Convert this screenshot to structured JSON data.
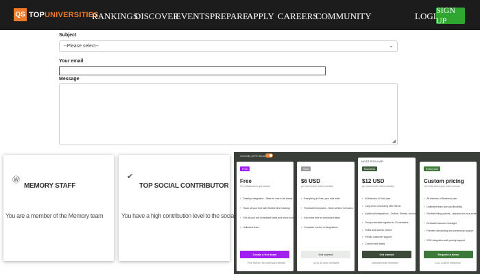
{
  "header": {
    "logo_mark": "QS",
    "logo_text_a": "TOP",
    "logo_text_b": "UNIVERSITIES",
    "nav": [
      "RANKINGS",
      "DISCOVER",
      "EVENTS",
      "PREPARE",
      "APPLY",
      "CAREERS",
      "COMMUNITY"
    ],
    "login_label": "LOGIN",
    "signup_label": "SIGN UP"
  },
  "form": {
    "subject_label": "Subject",
    "subject_value": "--Please select--",
    "email_label": "Your email",
    "email_value": "",
    "message_label": "Message",
    "message_value": ""
  },
  "badges": [
    {
      "icon": "wordpress-icon",
      "title": "MEMORY STAFF",
      "description": "You are a member of the Memory team"
    },
    {
      "icon": "checkmark-badge-icon",
      "title": "TOP SOCIAL CONTRIBUTOR",
      "description": "You have a high contribution level to the social aspects"
    }
  ],
  "pricing": {
    "toggle_label": "Annually (20% discount)",
    "popular_label": "MOST POPULAR",
    "plans": [
      {
        "tag": "Free",
        "tag_color": "#a020f0",
        "name": "Free",
        "subtitle": "For individuals to get started",
        "features": [
          "Desktop integration - Stats for free to all teams",
          "Track all your time with flexible time tracking",
          "Get all your pre-scheduled tasks and show work",
          "Unlimited team"
        ],
        "button": "Create a free team",
        "button_bg": "#a020f0",
        "button_fg": "#ffffff",
        "footnote": "Free forever. No credit card needed"
      },
      {
        "tag": "Solo",
        "tag_color": "#9a9a9a",
        "name": "$6 USD",
        "subtitle": "per user/month, billed monthly",
        "features": [
          "Everything in Free, plus bulk edits",
          "Timesheet templates - Store all time for teams",
          "Add extra time to scheduled tasks",
          "Complete control of integrations"
        ],
        "button": "Get started",
        "button_bg": "#e9ece8",
        "button_fg": "#555555",
        "footnote": "Up to 10 team members"
      },
      {
        "tag": "Business",
        "tag_color": "#3d5a3a",
        "name": "$12 USD",
        "subtitle": "per user/month, billed monthly",
        "features": [
          "All features of Solo plan",
          "Long-term scheduling with effects",
          "Additional integrations - Outline, Sheets, and more",
          "Group extended together to 10 members",
          "Roles and access control",
          "Priority customer support",
          "Control multi leads"
        ],
        "button": "Get started",
        "button_bg": "#3d4a3a",
        "button_fg": "#ffffff",
        "footnote": "Unlimited team members"
      },
      {
        "tag": "Enterprise",
        "tag_color": "#3d7a3a",
        "name": "Custom pricing",
        "subtitle": "Let's talk about your team's needs",
        "features": [
          "All features of Business plan",
          "Unlimited team size and flexibility",
          "Flexible billing options - adjusted for your scale",
          "Dedicated account manager",
          "Premier onboarding and community support",
          "SSO integration with priority support"
        ],
        "button": "Request a demo",
        "button_bg": "#3d7a3a",
        "button_fg": "#ffffff",
        "footnote": "1-on-1 call for enterprise"
      }
    ]
  }
}
